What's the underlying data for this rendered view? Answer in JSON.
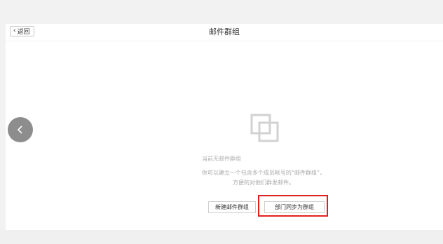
{
  "header": {
    "back_label": "返回",
    "title": "邮件群组"
  },
  "empty_state": {
    "icon": "stacked-squares-icon",
    "title": "当前无邮件群组",
    "description_line1": "你可以建立一个包含多个成员帐号的“邮件群组”，",
    "description_line2": "方便的对他们群发邮件。"
  },
  "actions": {
    "new_group_label": "新建邮件群组",
    "sync_dept_label": "部门同步为群组"
  },
  "colors": {
    "highlight": "#e02020",
    "nav_circle": "#8d8d8d"
  }
}
